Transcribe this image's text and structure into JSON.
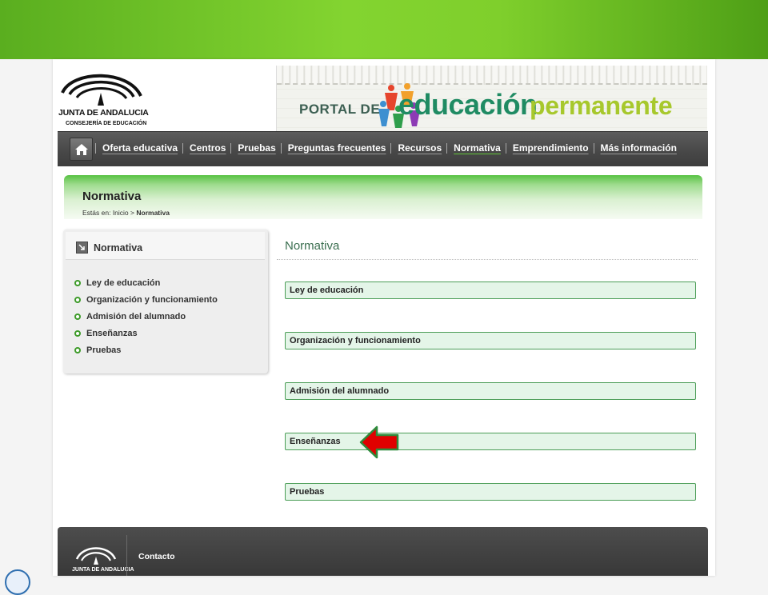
{
  "org_logo": {
    "line1": "JUNTA DE ANDALUCIA",
    "line2": "CONSEJERÍA DE EDUCACIÓN"
  },
  "banner": {
    "prefix": "PORTAL DE",
    "word1": "educación",
    "word2": "permanente",
    "colors": {
      "word1": "#1f8b63",
      "word2": "#a7c82c"
    }
  },
  "nav": {
    "home_icon": "home-icon",
    "items": [
      {
        "label": "Oferta educativa"
      },
      {
        "label": "Centros"
      },
      {
        "label": "Pruebas"
      },
      {
        "label": "Preguntas frecuentes"
      },
      {
        "label": "Recursos"
      },
      {
        "label": "Normativa",
        "active": true
      },
      {
        "label": "Emprendimiento"
      },
      {
        "label": "Más información"
      }
    ]
  },
  "page_header": {
    "title": "Normativa",
    "breadcrumb_prefix": "Estás en:",
    "breadcrumb_home": "Inicio",
    "breadcrumb_sep": ">",
    "breadcrumb_current": "Normativa"
  },
  "sidebar": {
    "title": "Normativa",
    "items": [
      {
        "label": "Ley de educación"
      },
      {
        "label": "Organización y funcionamiento"
      },
      {
        "label": "Admisión del alumnado"
      },
      {
        "label": "Enseñanzas"
      },
      {
        "label": "Pruebas"
      }
    ]
  },
  "main": {
    "title": "Normativa",
    "sections": [
      {
        "label": "Ley de educación"
      },
      {
        "label": "Organización y funcionamiento"
      },
      {
        "label": "Admisión del alumnado"
      },
      {
        "label": "Enseñanzas",
        "highlighted": true
      },
      {
        "label": "Pruebas"
      }
    ]
  },
  "footer": {
    "logo_label": "JUNTA DE ANDALUCIA",
    "contact": "Contacto"
  },
  "colors": {
    "accent_green": "#57c243",
    "nav_dark": "#474747",
    "section_border": "#4b9d57",
    "pointer_arrow": "#e00000"
  }
}
